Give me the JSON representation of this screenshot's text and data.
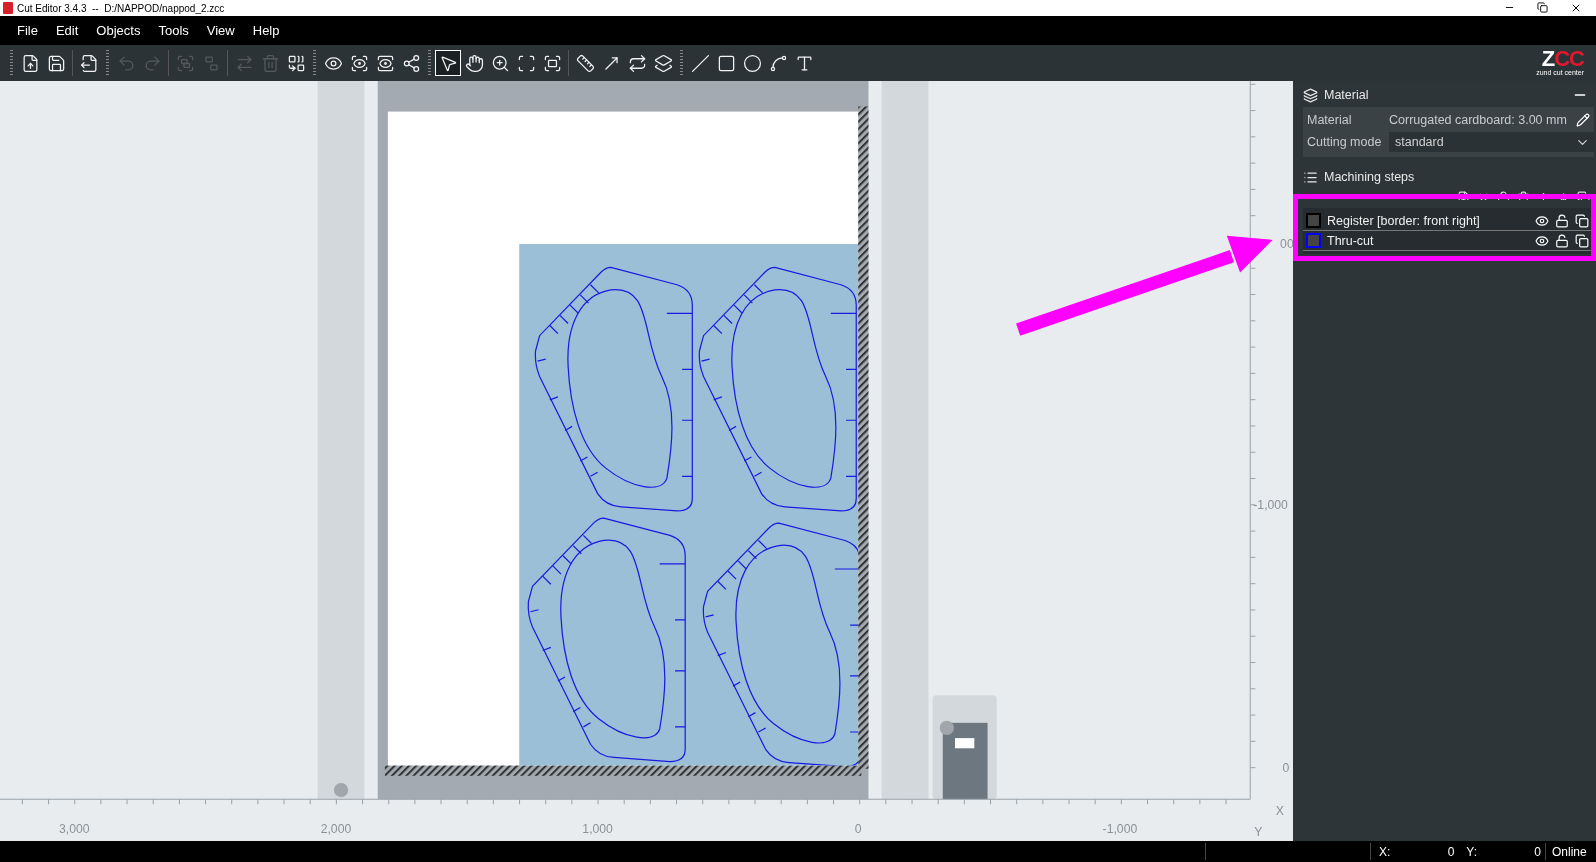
{
  "window": {
    "title": "Cut Editor 3.4.3  --  D:/NAPPOD/nappod_2.zcc"
  },
  "menu": [
    "File",
    "Edit",
    "Objects",
    "Tools",
    "View",
    "Help"
  ],
  "toolbar": {
    "tools": [
      {
        "selected": false,
        "disabled": false
      },
      {
        "selected": false,
        "disabled": false
      },
      {
        "selected": false,
        "disabled": false
      },
      {
        "selected": false,
        "disabled": true
      },
      {
        "selected": false,
        "disabled": true
      },
      {
        "selected": false,
        "disabled": true
      },
      {
        "selected": false,
        "disabled": true
      },
      {
        "selected": false,
        "disabled": true
      },
      {
        "selected": false,
        "disabled": true
      },
      {
        "selected": false,
        "disabled": false
      },
      {
        "selected": false,
        "disabled": false
      },
      {
        "selected": false,
        "disabled": false
      },
      {
        "selected": false,
        "disabled": false
      },
      {
        "selected": false,
        "disabled": false
      },
      {
        "selected": true,
        "disabled": false
      },
      {
        "selected": false,
        "disabled": false
      },
      {
        "selected": false,
        "disabled": false
      },
      {
        "selected": false,
        "disabled": false
      },
      {
        "selected": false,
        "disabled": false
      },
      {
        "selected": false,
        "disabled": false
      },
      {
        "selected": false,
        "disabled": false
      },
      {
        "selected": false,
        "disabled": false
      },
      {
        "selected": false,
        "disabled": false
      },
      {
        "selected": false,
        "disabled": false
      },
      {
        "selected": false,
        "disabled": false
      },
      {
        "selected": false,
        "disabled": false
      },
      {
        "selected": false,
        "disabled": false
      },
      {
        "selected": false,
        "disabled": false
      }
    ]
  },
  "logo": {
    "mark": "ZCC",
    "tagline": "zund cut center"
  },
  "canvas": {
    "x_labels": [
      "3,000",
      "2,000",
      "1,000",
      "0",
      "-1,000"
    ],
    "y_labels": [
      "00",
      "-1,000",
      "0"
    ],
    "x_axis": "X",
    "y_axis": "Y"
  },
  "material_panel": {
    "title": "Material",
    "material_label": "Material",
    "material_value": "Corrugated cardboard: 3.00 mm",
    "mode_label": "Cutting mode",
    "mode_value": "standard"
  },
  "machining_steps": {
    "title": "Machining steps",
    "steps": [
      {
        "name": "Register [border: front right]",
        "color": "#000000",
        "visible": true,
        "locked": false
      },
      {
        "name": "Thru-cut",
        "color": "#0000ff",
        "visible": true,
        "locked": false
      }
    ]
  },
  "status_bar": {
    "x_label": "X:",
    "x_value": "0",
    "y_label": "Y:",
    "y_value": "0",
    "connection": "Online"
  }
}
